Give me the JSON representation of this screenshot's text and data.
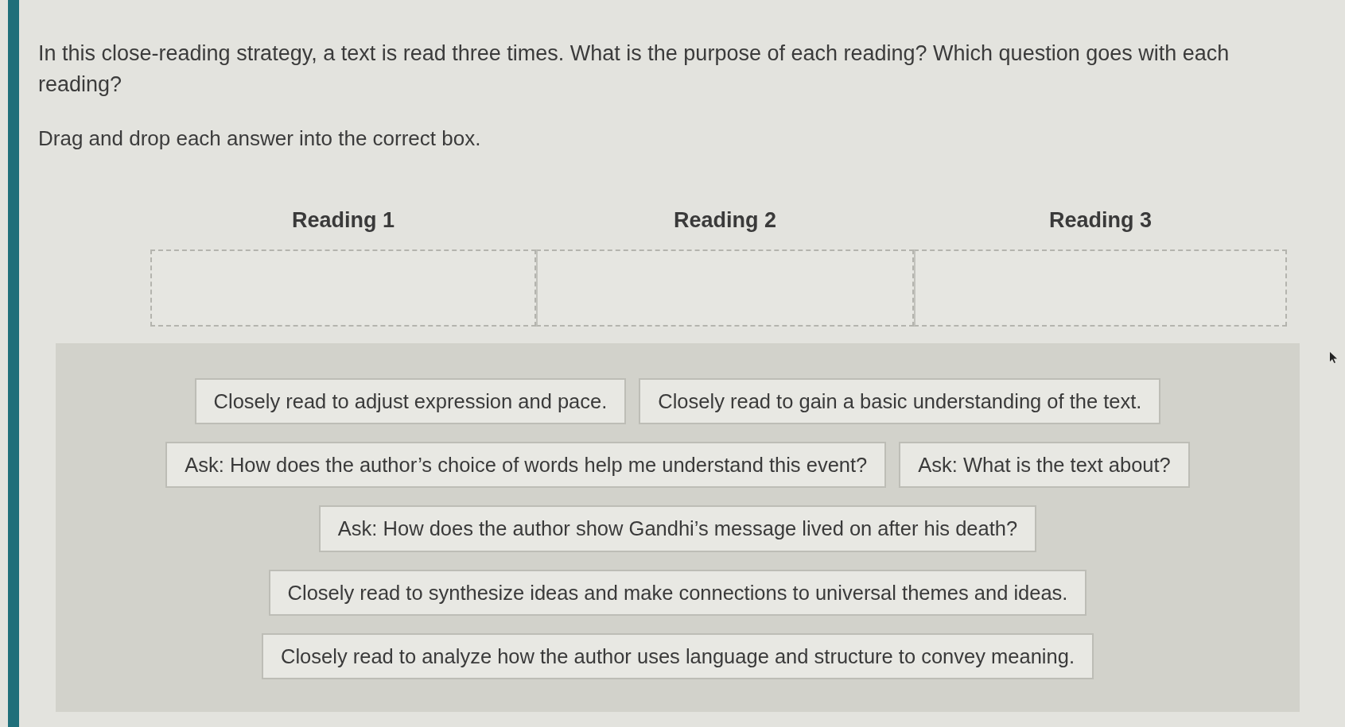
{
  "question": {
    "prompt": "In this close-reading strategy, a text is read three times. What is the purpose of each reading? Which question goes with each reading?",
    "instruction": "Drag and drop each answer into the correct box."
  },
  "drop_targets": [
    {
      "heading": "Reading 1"
    },
    {
      "heading": "Reading 2"
    },
    {
      "heading": "Reading 3"
    }
  ],
  "answer_rows": [
    {
      "tiles": [
        "Closely read to adjust expression and pace.",
        "Closely read to gain a basic understanding of the text."
      ]
    },
    {
      "tiles": [
        "Ask: How does the author’s choice of words help me understand this event?",
        "Ask: What is the text about?"
      ]
    },
    {
      "tiles": [
        "Ask: How does the author show Gandhi’s message lived on after his death?"
      ]
    },
    {
      "tiles": [
        "Closely read to synthesize ideas and make connections to universal themes and ideas."
      ]
    },
    {
      "tiles": [
        "Closely read to analyze how the author uses language and structure to convey meaning."
      ]
    }
  ]
}
